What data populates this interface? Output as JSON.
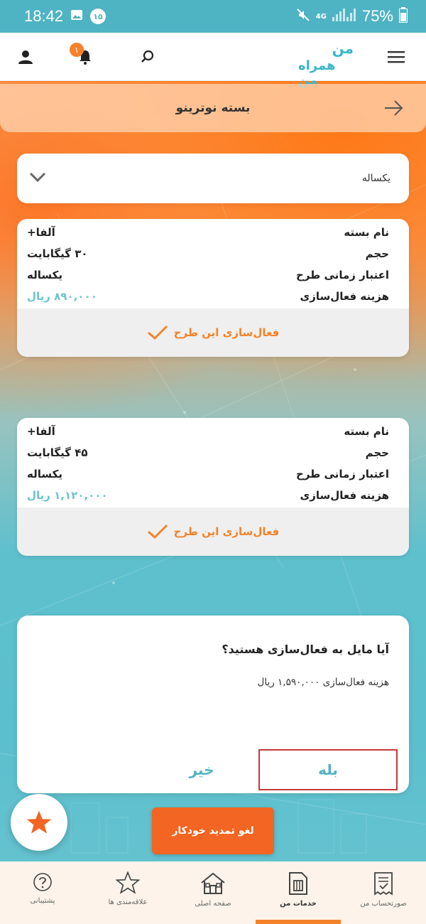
{
  "status_bar": {
    "time": "18:42",
    "notif_count": "۱۵",
    "network": "4G",
    "battery": "75%"
  },
  "header": {
    "logo_text": "همراه من",
    "logo_top": "من",
    "notif_badge": "۱"
  },
  "page": {
    "title": "بسته نوترینو"
  },
  "filter": {
    "selected": "یکساله"
  },
  "plans": [
    {
      "name_label": "نام بسته",
      "name": "آلفا+",
      "volume_label": "حجم",
      "volume": "۳۰ گیگابایت",
      "validity_label": "اعتبار زمانی طرح",
      "validity": "یکساله",
      "cost_label": "هزینه فعال‌سازی",
      "cost": "۸۹۰,۰۰۰ ریال",
      "action": "فعال‌سازی این طرح"
    },
    {
      "name_label": "نام بسته",
      "name": "آلفا+",
      "volume_label": "حجم",
      "volume": "۴۵ گیگابایت",
      "validity_label": "اعتبار زمانی طرح",
      "validity": "یکساله",
      "cost_label": "هزینه فعال‌سازی",
      "cost": "۱,۱۲۰,۰۰۰ ریال",
      "action": "فعال‌سازی این طرح"
    }
  ],
  "dialog": {
    "question": "آیا مایل به فعال‌سازی هستید؟",
    "cost_text": "هزینه فعال‌سازی ۱,۵۹۰,۰۰۰ ریال",
    "yes": "بله",
    "no": "خیر"
  },
  "cancel_button": "لغو تمدید خودکار",
  "nav": [
    {
      "label": "پشتیبانی",
      "icon": "help-icon"
    },
    {
      "label": "علاقه‌مندی ها",
      "icon": "star-outline-icon"
    },
    {
      "label": "صفحه اصلی",
      "icon": "home-icon"
    },
    {
      "label": "خدمات من",
      "icon": "sim-card-icon"
    },
    {
      "label": "صورتحساب من",
      "icon": "invoice-icon"
    }
  ],
  "colors": {
    "accent": "#f5822a",
    "teal": "#52b3c2",
    "price": "#6cc3d2"
  }
}
